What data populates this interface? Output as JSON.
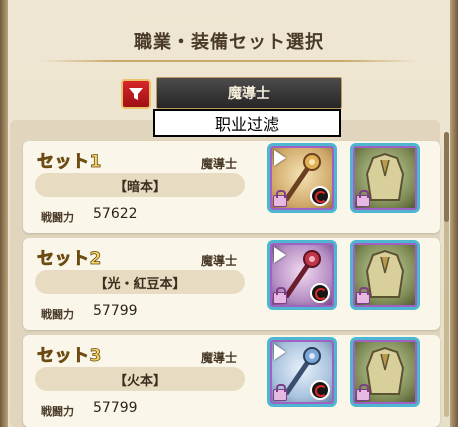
{
  "header": {
    "title": "職業・装備セット選択"
  },
  "filter": {
    "selected_job": "魔導士",
    "tooltip": "职业过滤"
  },
  "sets": [
    {
      "name": "セット1",
      "job": "魔導士",
      "label": "【暗本】",
      "power_label": "戦闘力",
      "power": "57622"
    },
    {
      "name": "セット2",
      "job": "魔導士",
      "label": "【光・紅豆本】",
      "power_label": "戦闘力",
      "power": "57799"
    },
    {
      "name": "セット3",
      "job": "魔導士",
      "label": "【火本】",
      "power_label": "戦闘力",
      "power": "57799"
    }
  ],
  "icons": {
    "filter": "filter-funnel-icon",
    "play": "play-icon",
    "lock": "lock-icon",
    "swap": "swap-icon",
    "weapon": "staff-weapon-icon",
    "armor": "robe-armor-icon"
  },
  "colors": {
    "accent_red": "#d8262b",
    "gold": "#f2d66a",
    "frame_blue": "#4fb6d2"
  }
}
